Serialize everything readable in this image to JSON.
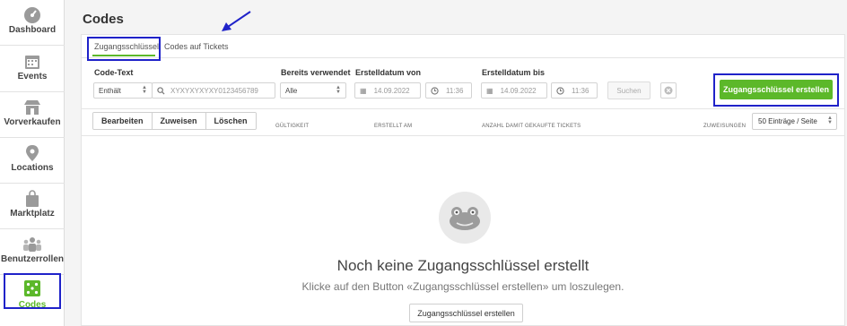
{
  "sidebar": {
    "items": [
      {
        "label": "Dashboard",
        "icon": "dashboard-icon"
      },
      {
        "label": "Events",
        "icon": "calendar-icon"
      },
      {
        "label": "Vorverkaufen",
        "icon": "store-icon"
      },
      {
        "label": "Locations",
        "icon": "location-pin-icon"
      },
      {
        "label": "Marktplatz",
        "icon": "shopping-bag-icon"
      },
      {
        "label": "Benutzerrollen",
        "icon": "users-icon"
      },
      {
        "label": "Codes",
        "icon": "dice-icon",
        "active": true
      }
    ]
  },
  "page": {
    "title": "Codes"
  },
  "tabs": [
    {
      "label": "Zugangsschlüssel",
      "active": true
    },
    {
      "label": "Codes auf Tickets"
    }
  ],
  "filters": {
    "code_text": {
      "label": "Code-Text",
      "mode": "Enthält",
      "placeholder": "XYXYXYXYXY0123456789"
    },
    "bereits_verwendet": {
      "label": "Bereits verwendet",
      "value": "Alle"
    },
    "erstelldatum_von": {
      "label": "Erstelldatum von",
      "date": "14.09.2022",
      "time": "11:36"
    },
    "erstelldatum_bis": {
      "label": "Erstelldatum bis",
      "date": "14.09.2022",
      "time": "11:36"
    },
    "search_label": "Suchen"
  },
  "create_button": "Zugangsschlüssel erstellen",
  "toolbar": {
    "edit": "Bearbeiten",
    "assign": "Zuweisen",
    "delete": "Löschen"
  },
  "columns": [
    "GÜLTIGKEIT",
    "ERSTELLT AM",
    "ANZAHL DAMIT GEKAUFTE TICKETS",
    "ZUWEISUNGEN"
  ],
  "per_page": "50 Einträge / Seite",
  "empty_state": {
    "title": "Noch keine Zugangsschlüssel erstellt",
    "subtitle": "Klicke auf den Button «Zugangsschlüssel erstellen» um loszulegen.",
    "button": "Zugangsschlüssel erstellen"
  },
  "colors": {
    "accent_green": "#5cb82a",
    "annotation_blue": "#1f22c9"
  }
}
